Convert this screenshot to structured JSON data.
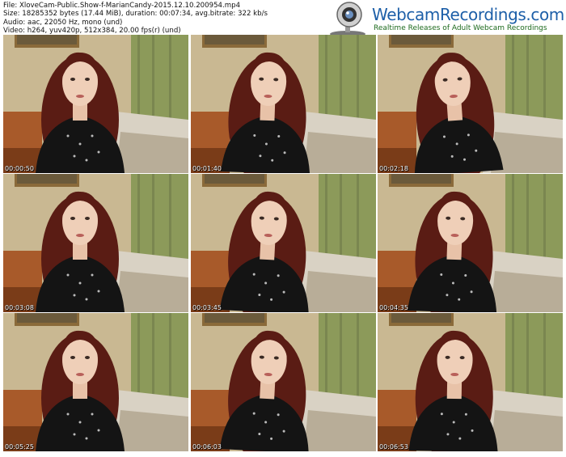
{
  "info": {
    "line1": "File: XloveCam-Public.Show-f-MarianCandy-2015.12.10.200954.mp4",
    "line2": "Size: 18285352 bytes (17.44 MiB), duration: 00:07:34, avg.bitrate: 322 kb/s",
    "line3": "Audio: aac, 22050 Hz, mono (und)",
    "line4": "Video: h264, yuv420p, 512x384, 20.00 fps(r) (und)"
  },
  "logo": {
    "title": "WebcamRecordings.com",
    "subtitle": "Realtime Releases of Adult Webcam Recordings",
    "icon": "webcam-icon"
  },
  "thumbnails": [
    {
      "timestamp": "00:00:50"
    },
    {
      "timestamp": "00:01:40"
    },
    {
      "timestamp": "00:02:18"
    },
    {
      "timestamp": "00:03:08"
    },
    {
      "timestamp": "00:03:45"
    },
    {
      "timestamp": "00:04:35"
    },
    {
      "timestamp": "00:05:25"
    },
    {
      "timestamp": "00:06:03"
    },
    {
      "timestamp": "00:06:53"
    }
  ],
  "colors": {
    "logo_blue": "#1d5fa8",
    "logo_green": "#1d6a1d",
    "wall": "#c9b892",
    "curtain": "#8c9a5a",
    "hair": "#5a1c14",
    "top": "#141414"
  }
}
